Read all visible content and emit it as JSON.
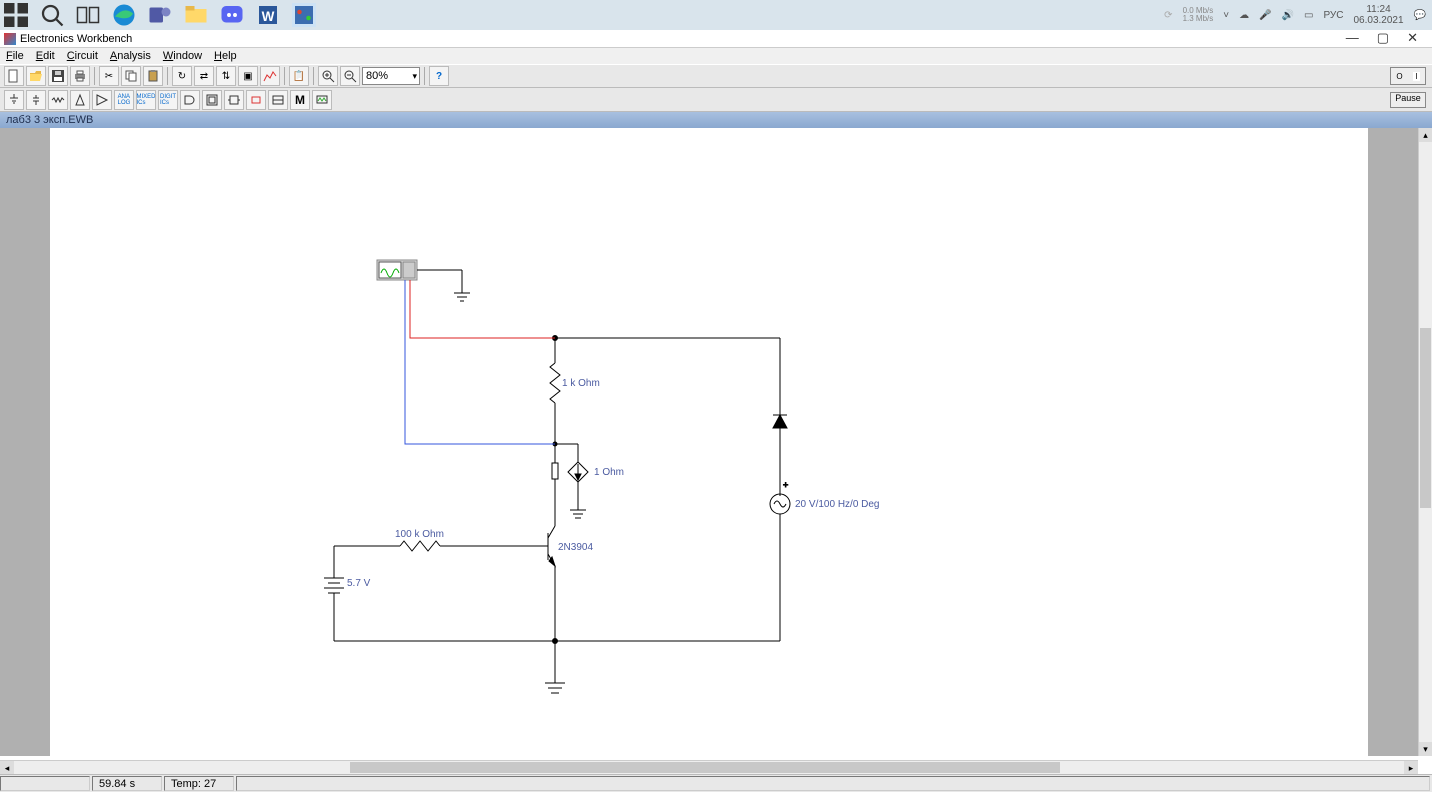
{
  "taskbar": {
    "netspeed_up": "0.0 Mb/s",
    "netspeed_down": "1.3 Mb/s",
    "lang": "РУС",
    "time": "11:24",
    "date": "06.03.2021"
  },
  "app": {
    "title": "Electronics Workbench"
  },
  "window_controls": {
    "min": "—",
    "max": "▢",
    "close": "✕"
  },
  "menu": {
    "file": "File",
    "edit": "Edit",
    "circuit": "Circuit",
    "analysis": "Analysis",
    "window": "Window",
    "help": "Help"
  },
  "toolbar": {
    "zoom": "80%",
    "pause": "Pause",
    "switch_on": "I",
    "switch_off": "O"
  },
  "document": {
    "title": "лаб3 3 эксп.EWB"
  },
  "schematic": {
    "r1_label": "1 k Ohm",
    "src_label": "1  Ohm",
    "r2_label": "100 k Ohm",
    "v1_label": "5.7 V",
    "q_label": "2N3904",
    "ac_label": "20 V/100 Hz/0 Deg"
  },
  "status": {
    "time": "59.84 s",
    "temp": "Temp:  27"
  }
}
